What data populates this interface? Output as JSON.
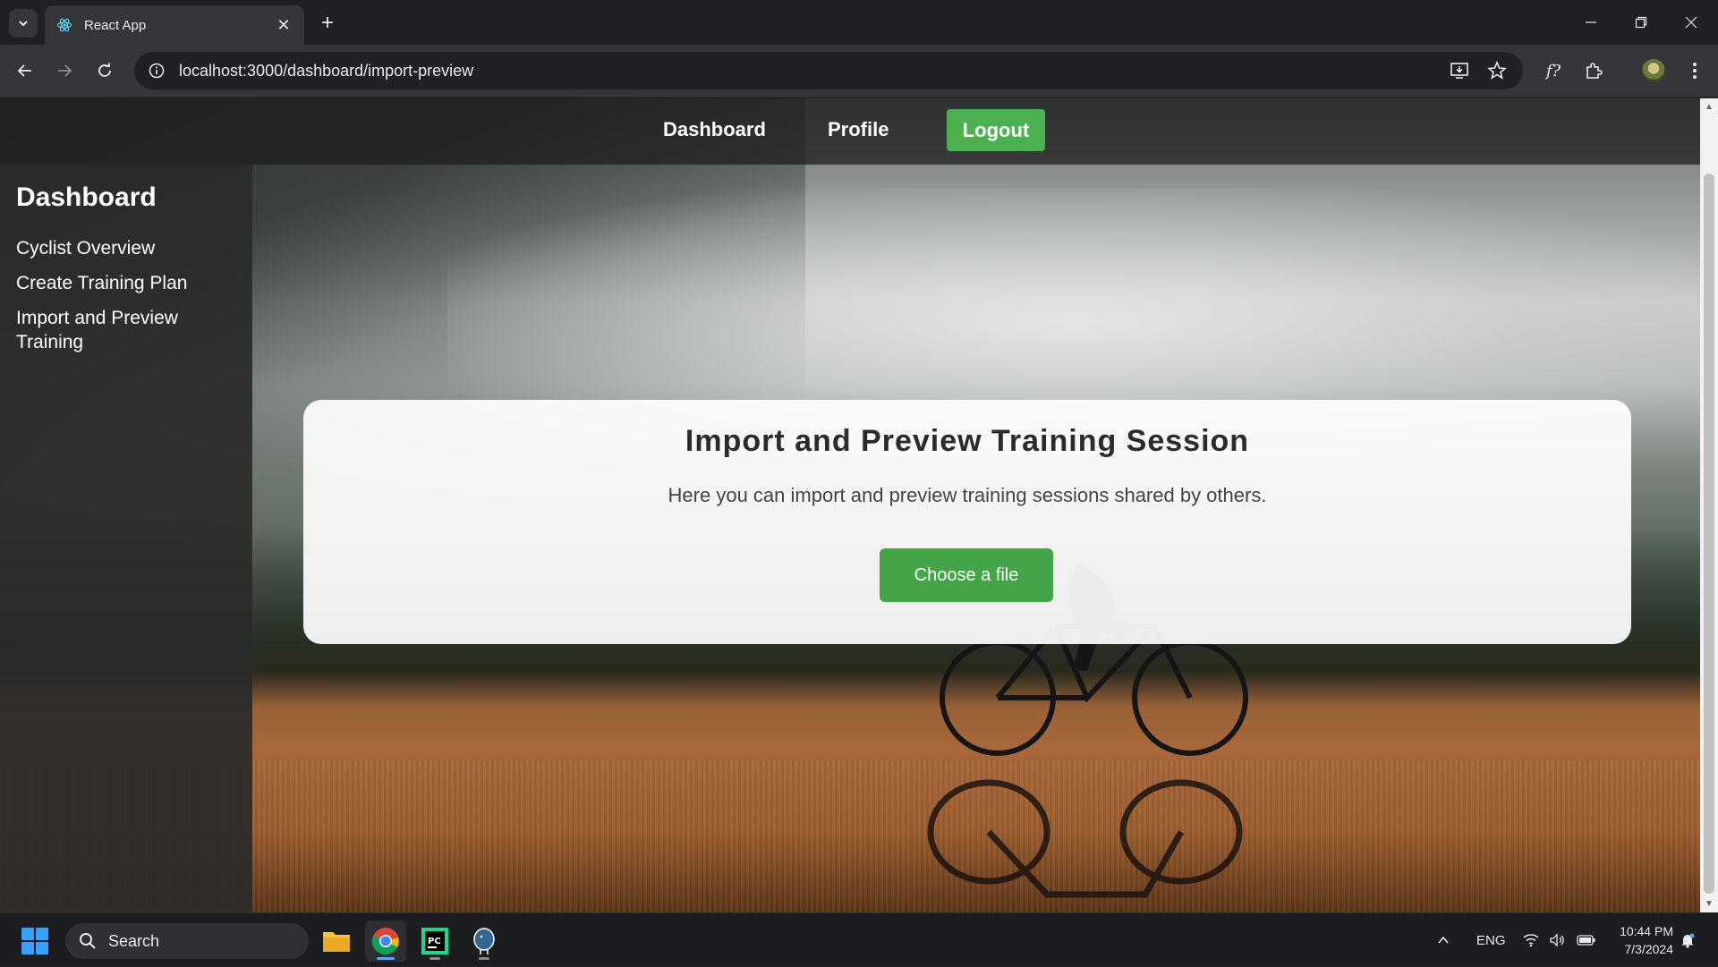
{
  "browser": {
    "tab_title": "React App",
    "url": "localhost:3000/dashboard/import-preview"
  },
  "nav": {
    "dashboard": "Dashboard",
    "profile": "Profile",
    "logout": "Logout"
  },
  "sidebar": {
    "title": "Dashboard",
    "items": [
      {
        "label": "Cyclist Overview"
      },
      {
        "label": "Create Training Plan"
      },
      {
        "label": "Import and Preview Training"
      }
    ]
  },
  "main": {
    "heading": "Import and Preview Training Session",
    "description": "Here you can import and preview training sessions shared by others.",
    "choose_file": "Choose a file"
  },
  "taskbar": {
    "search_label": "Search",
    "language": "ENG",
    "time": "10:44 PM",
    "date": "7/3/2024"
  },
  "colors": {
    "accent_green": "#4caf50",
    "browser_dark": "#35363a"
  }
}
